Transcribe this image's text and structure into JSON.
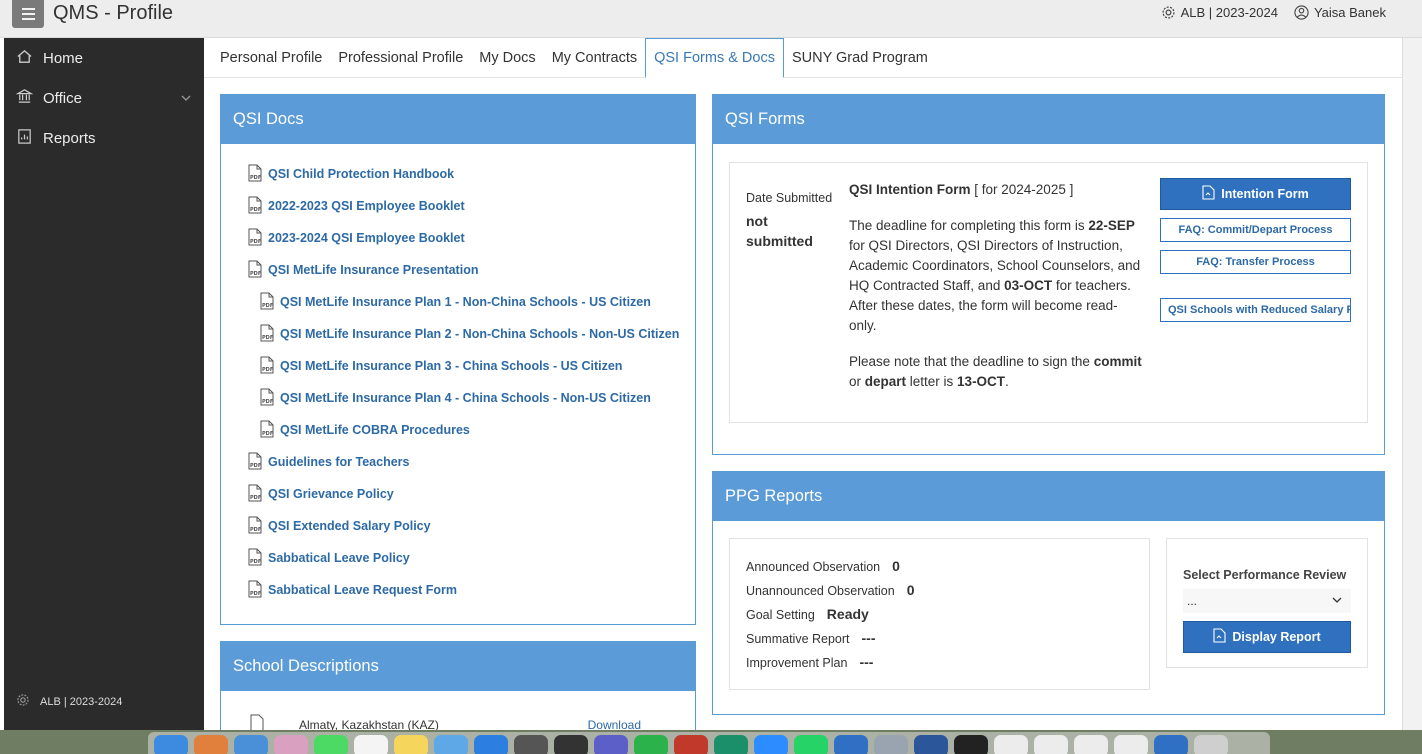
{
  "app": {
    "title": "QMS - Profile"
  },
  "topbar": {
    "school_year": "ALB | 2023-2024",
    "user": "Yaisa Banek"
  },
  "sidebar": {
    "items": [
      {
        "label": "Home"
      },
      {
        "label": "Office"
      },
      {
        "label": "Reports"
      }
    ],
    "footer": "ALB | 2023-2024"
  },
  "tabs": [
    {
      "label": "Personal Profile"
    },
    {
      "label": "Professional Profile"
    },
    {
      "label": "My Docs"
    },
    {
      "label": "My Contracts"
    },
    {
      "label": "QSI Forms & Docs"
    },
    {
      "label": "SUNY Grad Program"
    }
  ],
  "qsi_docs": {
    "title": "QSI Docs",
    "items": [
      "QSI Child Protection Handbook",
      "2022-2023 QSI Employee Booklet",
      "2023-2024 QSI Employee Booklet",
      "QSI MetLife Insurance Presentation",
      "QSI MetLife Insurance Plan 1 - Non-China Schools - US Citizen",
      "QSI MetLife Insurance Plan 2 - Non-China Schools - Non-US Citizen",
      "QSI MetLife Insurance Plan 3 - China Schools - US Citizen",
      "QSI MetLife Insurance Plan 4 - China Schools - Non-US Citizen",
      "QSI MetLife COBRA Procedures",
      "Guidelines for Teachers",
      "QSI Grievance Policy",
      "QSI Extended Salary Policy",
      "Sabbatical Leave Policy",
      "Sabbatical Leave Request Form"
    ]
  },
  "school_descriptions": {
    "title": "School Descriptions",
    "row": {
      "school": "Almaty, Kazakhstan (KAZ)",
      "link": "Download"
    }
  },
  "qsi_forms": {
    "title": "QSI Forms",
    "date_label": "Date Submitted",
    "date_value": "not submitted",
    "form_title": "QSI Intention Form",
    "form_year": "[ for 2024-2025 ]",
    "p1_a": "The deadline for completing this form is ",
    "p1_b": "22-SEP",
    "p1_c": " for QSI Directors, QSI Directors of Instruction, Academic Coordinators, School Counselors, and HQ Contracted Staff, and ",
    "p1_d": "03-OCT",
    "p1_e": " for teachers. After these dates, the form will become read-only.",
    "p2_a": "Please note that the deadline to sign the ",
    "p2_b": "commit",
    "p2_c": " or ",
    "p2_d": "depart",
    "p2_e": " letter is ",
    "p2_f": "13-OCT",
    "p2_g": ".",
    "btn_intention": "Intention Form",
    "btn_faq_commit": "FAQ: Commit/Depart Process",
    "btn_faq_transfer": "FAQ: Transfer Process",
    "btn_reduced": "QSI Schools with Reduced Salary F"
  },
  "ppg_reports": {
    "title": "PPG Reports",
    "rows": [
      {
        "label": "Announced Observation",
        "value": "0"
      },
      {
        "label": "Unannounced Observation",
        "value": "0"
      },
      {
        "label": "Goal Setting",
        "value": "Ready"
      },
      {
        "label": "Summative Report",
        "value": "---"
      },
      {
        "label": "Improvement Plan",
        "value": "---"
      }
    ],
    "select_label": "Select Performance Review",
    "select_value": "...",
    "display_btn": "Display Report"
  }
}
